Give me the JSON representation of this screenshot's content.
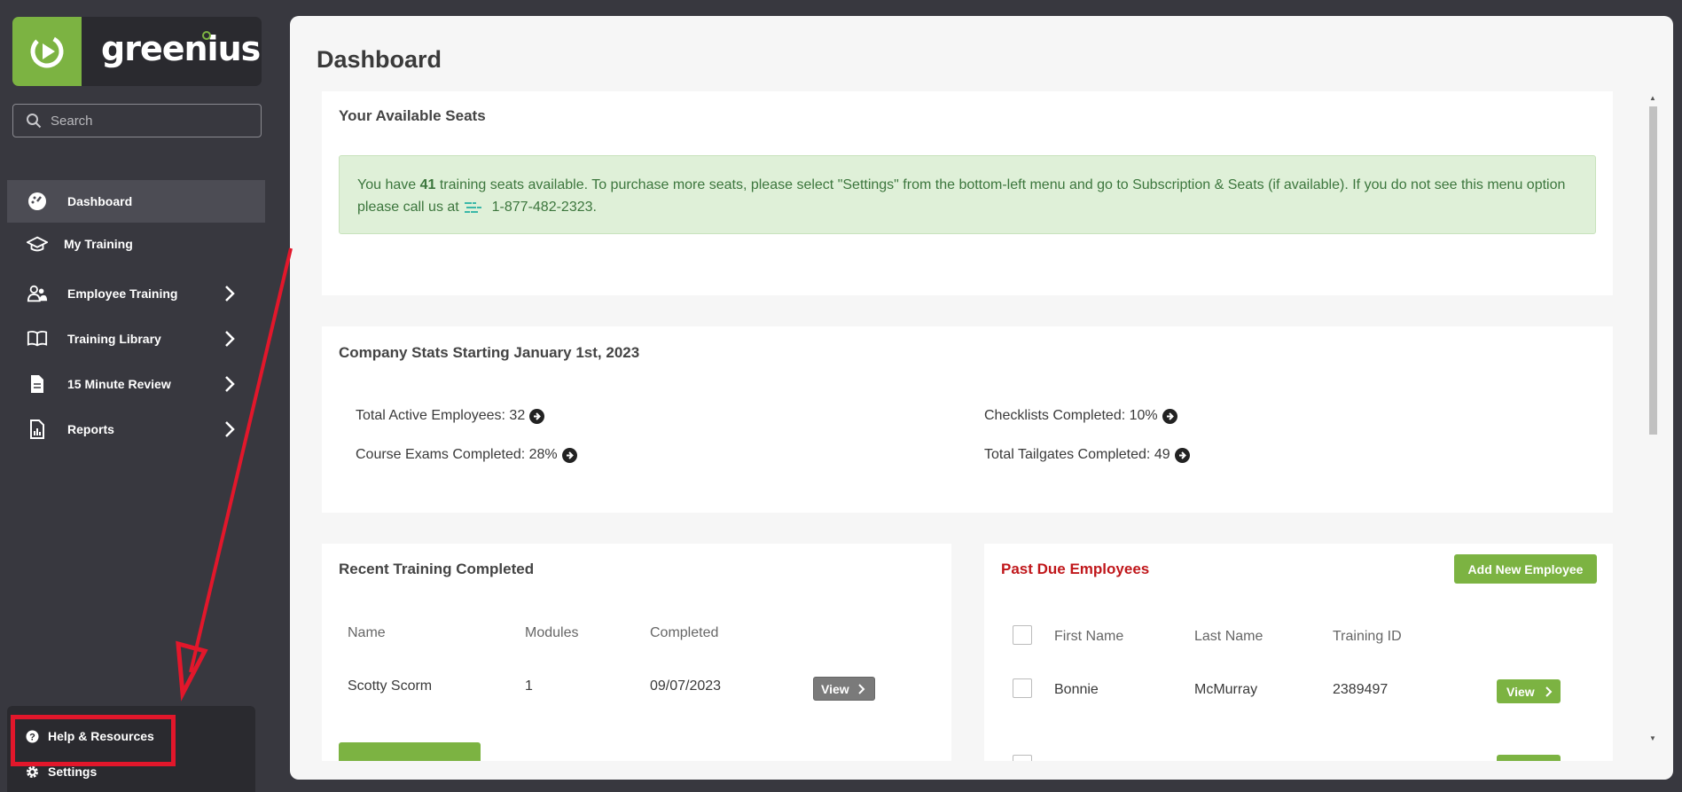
{
  "brand": {
    "name": "greenius",
    "accent": "#7cb342"
  },
  "sidebar": {
    "search_placeholder": "Search",
    "items": [
      {
        "label": "Dashboard",
        "icon": "dashboard-gauge-icon",
        "active": true
      },
      {
        "label": "My Training",
        "icon": "graduation-cap-icon"
      },
      {
        "label": "Employee Training",
        "icon": "users-icon",
        "has_submenu": true
      },
      {
        "label": "Training Library",
        "icon": "book-icon",
        "has_submenu": true
      },
      {
        "label": "15 Minute Review",
        "icon": "document-icon",
        "has_submenu": true
      },
      {
        "label": "Reports",
        "icon": "report-icon",
        "has_submenu": true
      }
    ],
    "bottom": {
      "help_label": "Help & Resources",
      "settings_label": "Settings"
    }
  },
  "main": {
    "title": "Dashboard",
    "seats": {
      "title": "Your Available Seats",
      "message_prefix": "You have",
      "seat_count": "41",
      "message_body": "training seats available. To purchase more seats, please select \"Settings\" from the bottom-left menu and go to Subscription & Seats (if available). If you do not see this menu option please call us at",
      "phone": "1-877-482-2323."
    },
    "stats": {
      "title": "Company Stats Starting January 1st, 2023",
      "items": [
        "Total Active Employees: 32",
        "Course Exams Completed: 28%",
        "Checklists Completed: 10%",
        "Total Tailgates Completed: 49"
      ]
    },
    "recent": {
      "title": "Recent Training Completed",
      "columns": [
        "Name",
        "Modules",
        "Completed"
      ],
      "rows": [
        {
          "name": "Scotty Scorm",
          "modules": "1",
          "completed": "09/07/2023",
          "action": "View"
        }
      ]
    },
    "past_due": {
      "title": "Past Due Employees",
      "add_button": "Add New Employee",
      "columns": [
        "First Name",
        "Last Name",
        "Training ID"
      ],
      "rows": [
        {
          "first": "Bonnie",
          "last": "McMurray",
          "id": "2389497",
          "action": "View"
        }
      ]
    }
  }
}
